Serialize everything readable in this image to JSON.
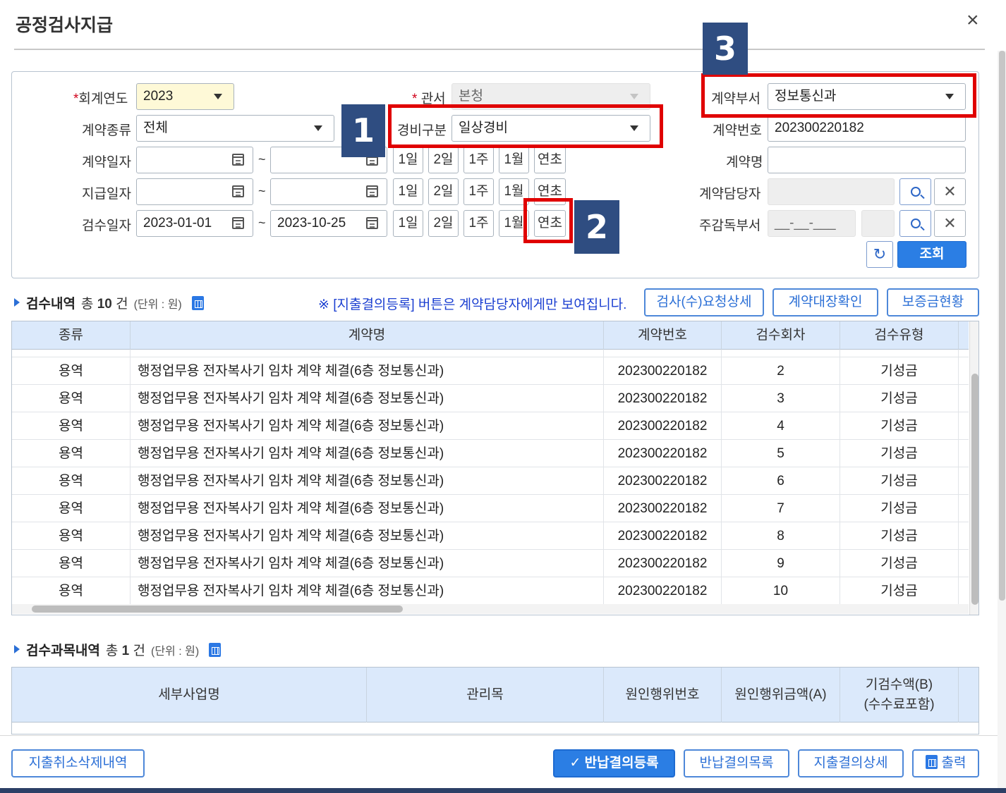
{
  "dialog": {
    "title": "공정검사지급",
    "close_glyph": "×"
  },
  "filters": {
    "fiscal_year": {
      "req_mark": "*",
      "label": "회계연도",
      "value": "2023"
    },
    "office": {
      "req_mark": "*",
      "label": "관서",
      "value": "본청"
    },
    "contract_dept": {
      "label": "계약부서",
      "value": "정보통신과"
    },
    "contract_type": {
      "label": "계약종류",
      "value": "전체"
    },
    "expense_type": {
      "label": "경비구분",
      "value": "일상경비"
    },
    "contract_no": {
      "label": "계약번호",
      "value": "202300220182"
    },
    "contract_date": {
      "label": "계약일자",
      "from": "",
      "to": ""
    },
    "contract_name": {
      "label": "계약명",
      "value": ""
    },
    "payment_date": {
      "label": "지급일자",
      "from": "",
      "to": ""
    },
    "manager": {
      "label": "계약담당자",
      "value": ""
    },
    "inspect_date": {
      "label": "검수일자",
      "from": "2023-01-01",
      "to": "2023-10-25"
    },
    "supervisor_dept": {
      "label": "주감독부서",
      "value": "__-__-___"
    },
    "tilde": "~",
    "quick_buttons": [
      "1일",
      "2일",
      "1주",
      "1월",
      "연초"
    ],
    "search_button": "조회",
    "reset_glyph": "↻",
    "clear_glyph": "✕"
  },
  "callouts": [
    "1",
    "2",
    "3"
  ],
  "inspections": {
    "title": "검수내역",
    "count_prefix": "총",
    "count": "10",
    "count_suffix": "건",
    "unit": "(단위 : 원)",
    "notice": "※ [지출결의등록] 버튼은 계약담당자에게만 보여집니다.",
    "buttons": [
      "검사(수)요청상세",
      "계약대장확인",
      "보증금현황"
    ],
    "columns": [
      "종류",
      "계약명",
      "계약번호",
      "검수회차",
      "검수유형"
    ],
    "rows": [
      [
        "용역",
        "행정업무용 전자복사기 임차 계약 체결(6층 정보통신과)",
        "202300220182",
        "2",
        "기성금"
      ],
      [
        "용역",
        "행정업무용 전자복사기 임차 계약 체결(6층 정보통신과)",
        "202300220182",
        "3",
        "기성금"
      ],
      [
        "용역",
        "행정업무용 전자복사기 임차 계약 체결(6층 정보통신과)",
        "202300220182",
        "4",
        "기성금"
      ],
      [
        "용역",
        "행정업무용 전자복사기 임차 계약 체결(6층 정보통신과)",
        "202300220182",
        "5",
        "기성금"
      ],
      [
        "용역",
        "행정업무용 전자복사기 임차 계약 체결(6층 정보통신과)",
        "202300220182",
        "6",
        "기성금"
      ],
      [
        "용역",
        "행정업무용 전자복사기 임차 계약 체결(6층 정보통신과)",
        "202300220182",
        "7",
        "기성금"
      ],
      [
        "용역",
        "행정업무용 전자복사기 임차 계약 체결(6층 정보통신과)",
        "202300220182",
        "8",
        "기성금"
      ],
      [
        "용역",
        "행정업무용 전자복사기 임차 계약 체결(6층 정보통신과)",
        "202300220182",
        "9",
        "기성금"
      ],
      [
        "용역",
        "행정업무용 전자복사기 임차 계약 체결(6층 정보통신과)",
        "202300220182",
        "10",
        "기성금"
      ]
    ]
  },
  "subjects": {
    "title": "검수과목내역",
    "count_prefix": "총",
    "count": "1",
    "count_suffix": "건",
    "unit": "(단위 : 원)",
    "columns": [
      "세부사업명",
      "관리목",
      "원인행위번호",
      "원인행위금액(A)",
      "기검수액(B)",
      "(수수료포함)"
    ]
  },
  "footer": {
    "cancel_delete": "지출취소삭제내역",
    "check_glyph": "✓",
    "refund_register": "반납결의등록",
    "refund_list": "반납결의목록",
    "expense_detail": "지출결의상세",
    "print": "출력"
  }
}
